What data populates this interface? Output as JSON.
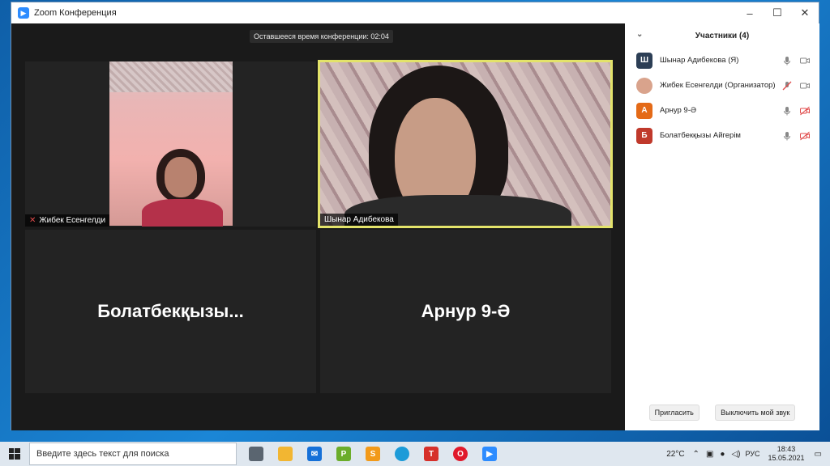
{
  "window": {
    "title": "Zoom Конференция"
  },
  "meeting": {
    "timer_text": "Оставшееся время конференции: 02:04",
    "tiles": [
      {
        "name": "Жибек Есенгелди",
        "muted": true
      },
      {
        "name": "Шынар Адибекова",
        "active_speaker": true
      },
      {
        "name": "Болатбекқызы..."
      },
      {
        "name": "Арнур 9-Ә"
      }
    ]
  },
  "participants_panel": {
    "title": "Участники (4)",
    "participants": [
      {
        "initial": "Ш",
        "color": "#2c3e55",
        "name": "Шынар Адибекова (Я)",
        "mic": "on",
        "video": "on"
      },
      {
        "initial": "",
        "color": "#d9a38c",
        "name": "Жибек Есенгелди (Организатор)",
        "mic": "muted",
        "video": "on"
      },
      {
        "initial": "А",
        "color": "#e46a17",
        "name": "Арнур 9-Ә",
        "mic": "on",
        "video": "off"
      },
      {
        "initial": "Б",
        "color": "#c0392b",
        "name": "Болатбекқызы Айгерім",
        "mic": "on",
        "video": "off"
      }
    ],
    "invite_label": "Пригласить",
    "mute_me_label": "Выключить мой звук"
  },
  "taskbar": {
    "search_placeholder": "Введите здесь текст для поиска",
    "apps": [
      {
        "icon": "task-view-icon",
        "label": "",
        "color": "#5a6570"
      },
      {
        "icon": "file-explorer-icon",
        "label": "",
        "color": "#f2b632"
      },
      {
        "icon": "mail-icon",
        "label": "",
        "color": "#1570d8"
      },
      {
        "icon": "p-app-icon",
        "label": "P",
        "color": "#6bad2a"
      },
      {
        "icon": "s-app-icon",
        "label": "S",
        "color": "#f29a1a"
      },
      {
        "icon": "edge-icon",
        "label": "",
        "color": "#1c9bd8"
      },
      {
        "icon": "t-app-icon",
        "label": "T",
        "color": "#d6302a"
      },
      {
        "icon": "opera-icon",
        "label": "",
        "color": "#e0192b"
      },
      {
        "icon": "zoom-icon",
        "label": "",
        "color": "#2d8cff"
      }
    ],
    "temperature": "22°C",
    "language": "РУС",
    "time": "18:43",
    "date": "15.05.2021"
  }
}
